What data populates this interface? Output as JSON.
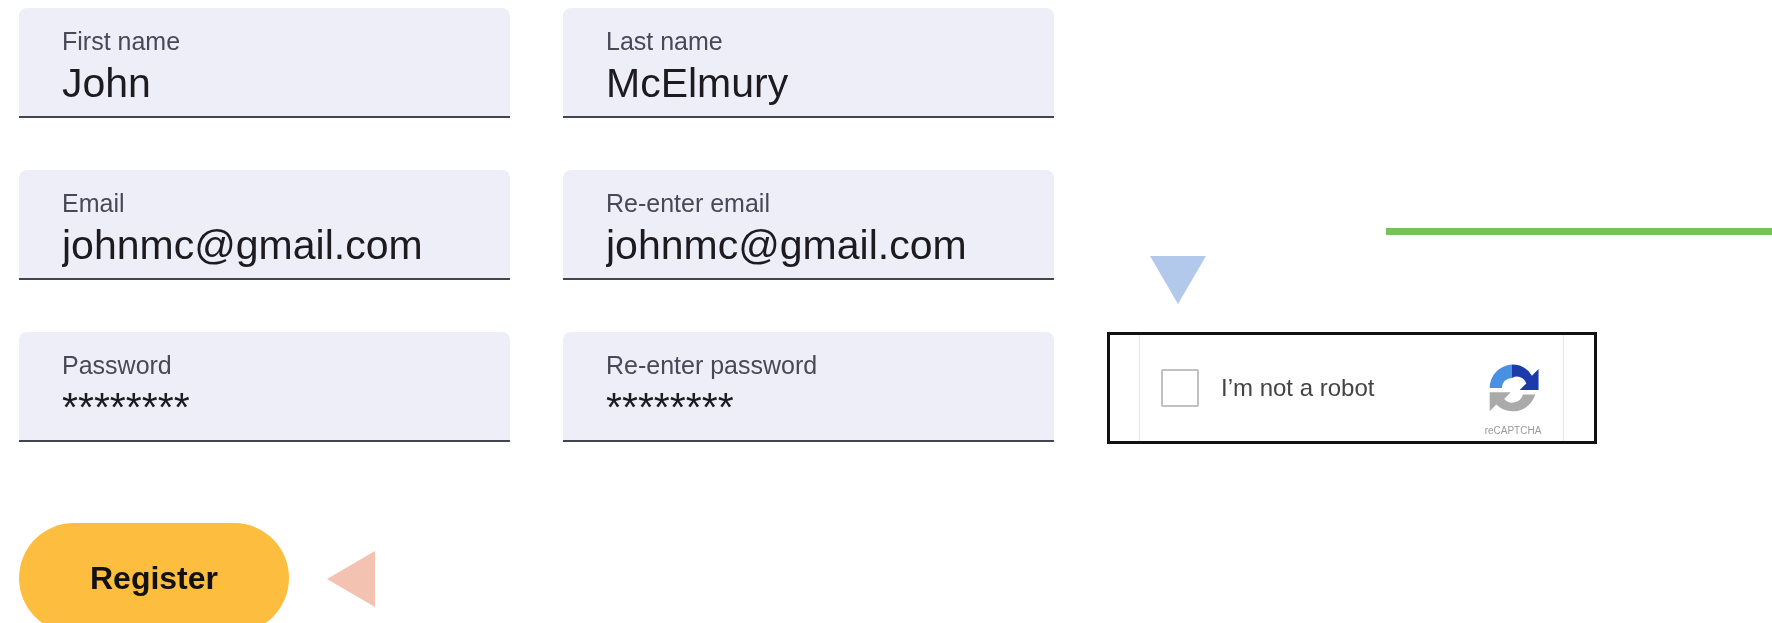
{
  "fields": [
    {
      "label": "First name",
      "value": "John"
    },
    {
      "label": "Last name",
      "value": "McElmury"
    },
    {
      "label": "Email",
      "value": "johnmc@gmail.com"
    },
    {
      "label": "Re-enter email",
      "value": "johnmc@gmail.com"
    },
    {
      "label": "Password",
      "value": "********"
    },
    {
      "label": "Re-enter password",
      "value": "********"
    }
  ],
  "recaptcha": {
    "label": "I’m not a robot",
    "checked": false,
    "brand": "reCAPTCHA"
  },
  "register_button": {
    "label": "Register"
  }
}
